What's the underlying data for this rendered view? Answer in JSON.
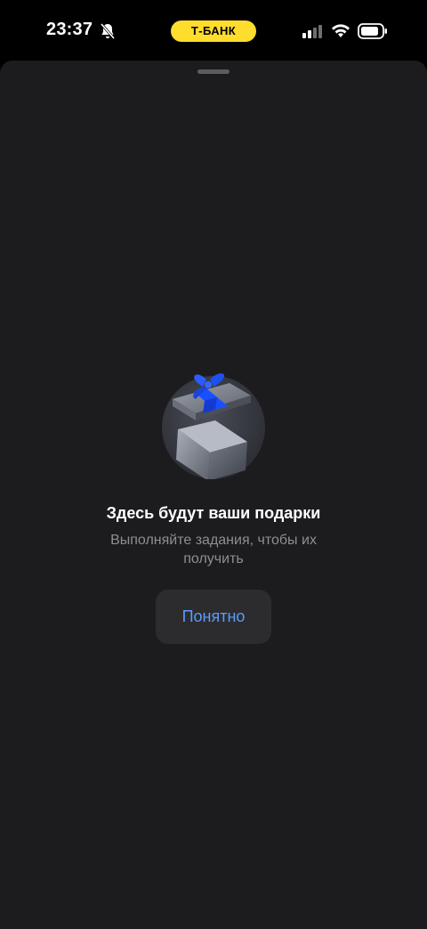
{
  "status_bar": {
    "time": "23:37",
    "bank_label": "Т-БАНК",
    "icons": [
      "bell-muted-icon",
      "cellular-signal-icon",
      "wifi-icon",
      "battery-icon"
    ]
  },
  "sheet": {
    "illustration_icon": "gift-box-icon",
    "title": "Здесь будут ваши подарки",
    "subtitle": "Выполняйте задания, чтобы их получить",
    "button_label": "Понятно"
  },
  "colors": {
    "background": "#1c1c1e",
    "accent": "#5b9bff",
    "bank_yellow": "#ffdd2d",
    "subtitle_gray": "#8e8e93",
    "ribbon_blue": "#1a4fff"
  }
}
